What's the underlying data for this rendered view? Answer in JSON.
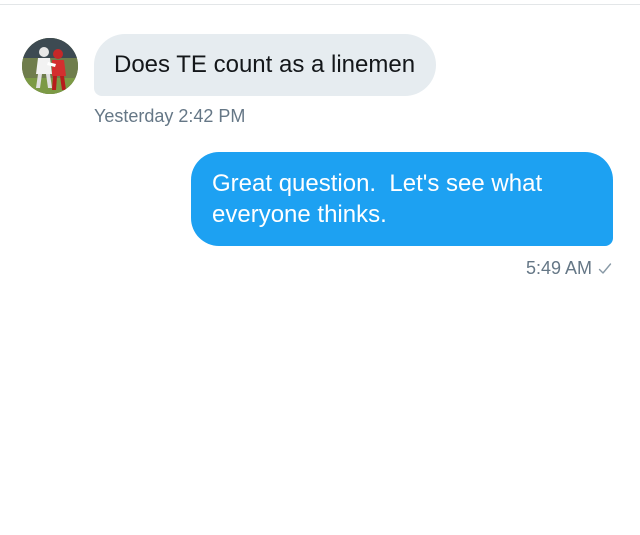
{
  "conversation": {
    "incoming": {
      "text": "Does TE count as a linemen",
      "timestamp": "Yesterday 2:42 PM",
      "avatar_icon": "football-player-avatar"
    },
    "outgoing": {
      "text": "Great question.  Let's see what everyone thinks.",
      "timestamp": "5:49 AM",
      "status_icon": "check-icon"
    }
  },
  "colors": {
    "incoming_bubble": "#e6ecf0",
    "outgoing_bubble": "#1da1f2",
    "timestamp": "#657786"
  }
}
